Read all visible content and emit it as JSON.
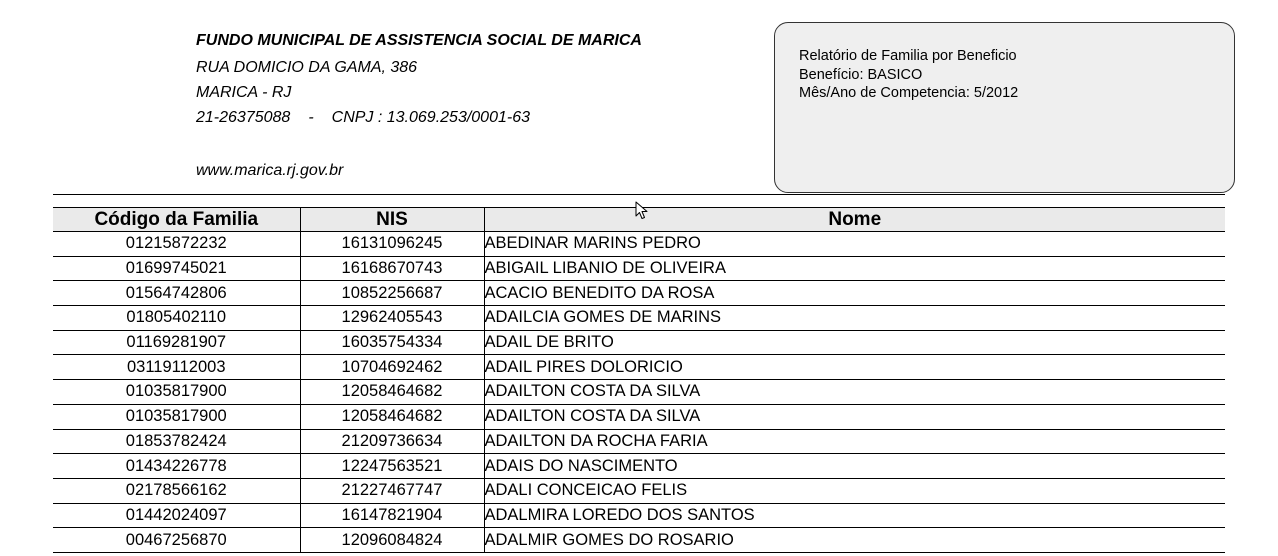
{
  "header": {
    "org_name": "FUNDO MUNICIPAL DE ASSISTENCIA SOCIAL DE MARICA",
    "address": "RUA DOMICIO DA GAMA, 386",
    "city": "MARICA - RJ",
    "phone": "21-26375088",
    "phone_separator": "-",
    "cnpj": "CNPJ : 13.069.253/0001-63",
    "website": "www.marica.rj.gov.br"
  },
  "report": {
    "title": "Relatório de Familia por Beneficio",
    "benefit": "Benefício: BASICO",
    "period": "Mês/Ano de Competencia: 5/2012"
  },
  "table": {
    "columns": [
      "Código da Familia",
      "NIS",
      "Nome"
    ],
    "rows": [
      {
        "code": "01215872232",
        "nis": "16131096245",
        "name": "ABEDINAR MARINS PEDRO"
      },
      {
        "code": "01699745021",
        "nis": "16168670743",
        "name": "ABIGAIL LIBANIO DE OLIVEIRA"
      },
      {
        "code": "01564742806",
        "nis": "10852256687",
        "name": "ACACIO BENEDITO DA ROSA"
      },
      {
        "code": "01805402110",
        "nis": "12962405543",
        "name": "ADAILCIA GOMES DE MARINS"
      },
      {
        "code": "01169281907",
        "nis": "16035754334",
        "name": "ADAIL DE BRITO"
      },
      {
        "code": "03119112003",
        "nis": "10704692462",
        "name": "ADAIL PIRES DOLORICIO"
      },
      {
        "code": "01035817900",
        "nis": "12058464682",
        "name": "ADAILTON COSTA DA SILVA"
      },
      {
        "code": "01035817900",
        "nis": "12058464682",
        "name": "ADAILTON COSTA DA SILVA"
      },
      {
        "code": "01853782424",
        "nis": "21209736634",
        "name": "ADAILTON DA ROCHA FARIA"
      },
      {
        "code": "01434226778",
        "nis": "12247563521",
        "name": "ADAIS DO NASCIMENTO"
      },
      {
        "code": "02178566162",
        "nis": "21227467747",
        "name": "ADALI CONCEICAO FELIS"
      },
      {
        "code": "01442024097",
        "nis": "16147821904",
        "name": "ADALMIRA LOREDO DOS SANTOS"
      },
      {
        "code": "00467256870",
        "nis": "12096084824",
        "name": "ADALMIR GOMES DO ROSARIO"
      }
    ]
  },
  "cursor": {
    "icon": "mouse-pointer-icon"
  }
}
